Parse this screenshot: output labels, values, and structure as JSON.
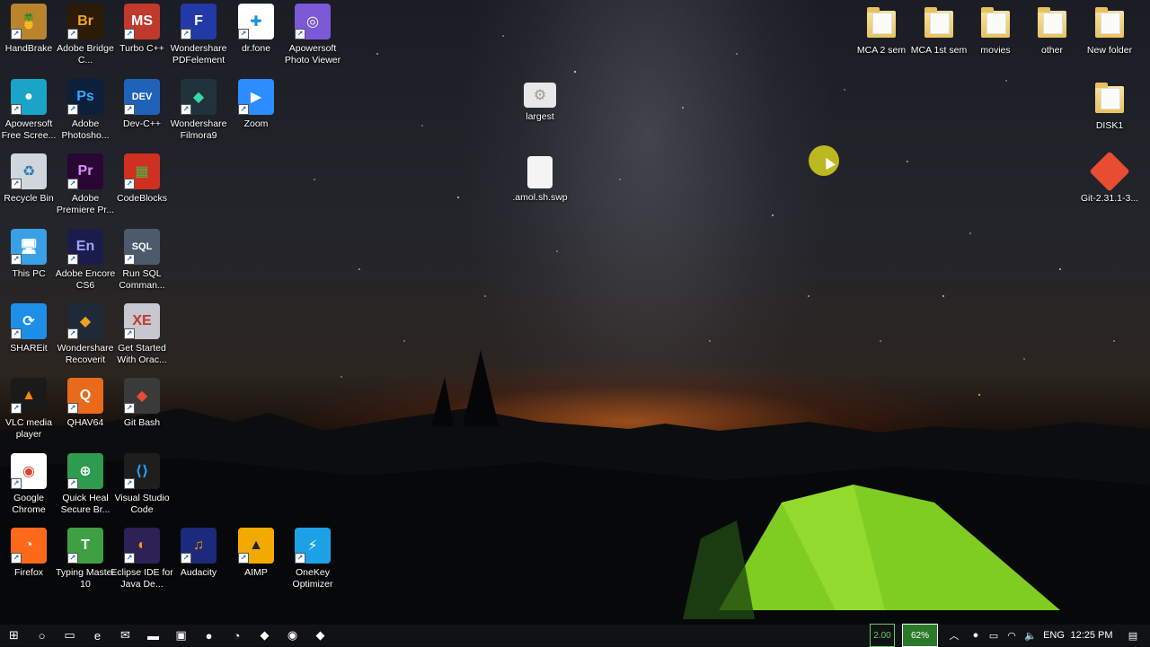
{
  "desktop": {
    "left_icons": [
      {
        "label": "HandBrake",
        "icon": "handbrake-icon",
        "color": "#b9842c",
        "glyph": "🍍"
      },
      {
        "label": "Adobe Bridge C...",
        "icon": "adobe-bridge-icon",
        "color": "#2b1b07",
        "glyph": "Br",
        "fg": "#f0a529"
      },
      {
        "label": "Turbo C++",
        "icon": "turbo-cpp-icon",
        "color": "#c0392b",
        "glyph": "MS"
      },
      {
        "label": "Wondershare PDFelement",
        "icon": "pdfelement-icon",
        "color": "#223aa8",
        "glyph": "F"
      },
      {
        "label": "dr.fone",
        "icon": "drfone-icon",
        "color": "#ffffff",
        "glyph": "✚",
        "fg": "#1b8fe0"
      },
      {
        "label": "Apowersoft Photo Viewer",
        "icon": "photo-viewer-icon",
        "color": "#7c59d6",
        "glyph": "◎"
      },
      {
        "label": "Apowersoft Free Scree...",
        "icon": "screen-recorder-icon",
        "color": "#1aa5c8",
        "glyph": "●"
      },
      {
        "label": "Adobe Photosho...",
        "icon": "photoshop-icon",
        "color": "#0c1f3b",
        "glyph": "Ps",
        "fg": "#31a8ff"
      },
      {
        "label": "Dev-C++",
        "icon": "dev-cpp-icon",
        "color": "#1e63b8",
        "glyph": "DEV"
      },
      {
        "label": "Wondershare Filmora9",
        "icon": "filmora-icon",
        "color": "#22323a",
        "glyph": "◆",
        "fg": "#38d6a8"
      },
      {
        "label": "Zoom",
        "icon": "zoom-icon",
        "color": "#2d8cff",
        "glyph": "▶"
      },
      {
        "label": "Recycle Bin",
        "icon": "recycle-bin-icon",
        "color": "#cfd6dc",
        "glyph": "♻",
        "fg": "#2a7ab0"
      },
      {
        "label": "Adobe Premiere Pr...",
        "icon": "premiere-icon",
        "color": "#2a0634",
        "glyph": "Pr",
        "fg": "#d88cff"
      },
      {
        "label": "CodeBlocks",
        "icon": "codeblocks-icon",
        "color": "#d03020",
        "glyph": "▦",
        "fg": "#48b848"
      },
      {
        "label": "This PC",
        "icon": "this-pc-icon",
        "color": "#3aa0e6",
        "glyph": "🖥"
      },
      {
        "label": "Adobe Encore CS6",
        "icon": "encore-icon",
        "color": "#1a1d4b",
        "glyph": "En",
        "fg": "#9aa4ff"
      },
      {
        "label": "Run SQL Comman...",
        "icon": "sql-command-icon",
        "color": "#4b5b6b",
        "glyph": "SQL"
      },
      {
        "label": "SHAREit",
        "icon": "shareit-icon",
        "color": "#1d8fe8",
        "glyph": "⟳"
      },
      {
        "label": "Wondershare Recoverit",
        "icon": "recoverit-icon",
        "color": "#1e2a38",
        "glyph": "◆",
        "fg": "#f0a020"
      },
      {
        "label": "Get Started With Orac...",
        "icon": "oracle-icon",
        "color": "#c7c7d0",
        "glyph": "XE",
        "fg": "#c0392b"
      },
      {
        "label": "VLC media player",
        "icon": "vlc-icon",
        "color": "#1a1a1a",
        "glyph": "▲",
        "fg": "#ff8800"
      },
      {
        "label": "QHAV64",
        "icon": "qhav-icon",
        "color": "#e86a1a",
        "glyph": "Q"
      },
      {
        "label": "Git Bash",
        "icon": "git-bash-icon",
        "color": "#3a3a3a",
        "glyph": "◆",
        "fg": "#e84d31"
      },
      {
        "label": "Google Chrome",
        "icon": "chrome-icon",
        "color": "#ffffff",
        "glyph": "◉",
        "fg": "#db4437"
      },
      {
        "label": "Quick Heal Secure Br...",
        "icon": "quickheal-icon",
        "color": "#2e9b4f",
        "glyph": "⊕"
      },
      {
        "label": "Visual Studio Code",
        "icon": "vscode-icon",
        "color": "#1e1e1e",
        "glyph": "⟨⟩",
        "fg": "#2f9df4"
      },
      {
        "label": "Firefox",
        "icon": "firefox-icon",
        "color": "#ff6a1a",
        "glyph": "◔"
      },
      {
        "label": "Typing Master 10",
        "icon": "typing-master-icon",
        "color": "#3fa043",
        "glyph": "T"
      },
      {
        "label": "Eclipse IDE for Java De...",
        "icon": "eclipse-icon",
        "color": "#2c2255",
        "glyph": "◐",
        "fg": "#f7941e"
      },
      {
        "label": "Audacity",
        "icon": "audacity-icon",
        "color": "#1b2a7a",
        "glyph": "♫",
        "fg": "#ff8a00"
      },
      {
        "label": "AIMP",
        "icon": "aimp-icon",
        "color": "#f2a900",
        "glyph": "▲",
        "fg": "#222"
      },
      {
        "label": "OneKey Optimizer",
        "icon": "onekey-optimizer-icon",
        "color": "#1da1e6",
        "glyph": "⚡"
      }
    ],
    "center_icons": [
      {
        "label": "largest",
        "icon": "largest-file-icon"
      },
      {
        "label": ".amol.sh.swp",
        "icon": "swp-file-icon"
      }
    ],
    "right_icons": [
      {
        "label": "MCA 2 sem",
        "icon": "folder-icon"
      },
      {
        "label": "MCA 1st sem",
        "icon": "folder-icon"
      },
      {
        "label": "movies",
        "icon": "folder-icon"
      },
      {
        "label": "other",
        "icon": "folder-icon"
      },
      {
        "label": "New folder",
        "icon": "folder-icon"
      },
      {
        "label": "DISK1",
        "icon": "folder-icon"
      },
      {
        "label": "Git-2.31.1-3...",
        "icon": "git-installer-icon"
      }
    ]
  },
  "taskbar": {
    "pinned": [
      {
        "name": "start-icon",
        "glyph": "⊞"
      },
      {
        "name": "cortana-icon",
        "glyph": "○"
      },
      {
        "name": "task-view-icon",
        "glyph": "▭"
      },
      {
        "name": "edge-icon",
        "glyph": "e"
      },
      {
        "name": "mail-icon",
        "glyph": "✉"
      },
      {
        "name": "file-explorer-icon",
        "glyph": "▬"
      },
      {
        "name": "store-icon",
        "glyph": "▣"
      },
      {
        "name": "app-icon",
        "glyph": "●"
      },
      {
        "name": "firefox-taskbar-icon",
        "glyph": "◔"
      },
      {
        "name": "git-taskbar-icon",
        "glyph": "◆"
      },
      {
        "name": "chrome-taskbar-icon",
        "glyph": "◉"
      },
      {
        "name": "git-bash-taskbar-icon",
        "glyph": "◆"
      }
    ],
    "battery_a": "2.00",
    "battery_b": "62%",
    "language": "ENG",
    "time": "12:25 PM"
  }
}
